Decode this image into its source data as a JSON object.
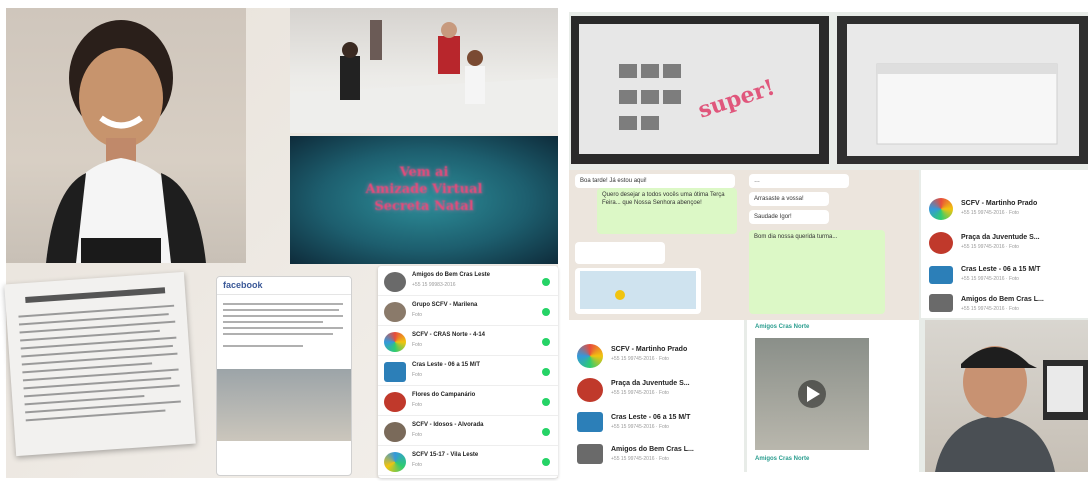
{
  "left_collage": {
    "banner_lines": [
      "Vem ai",
      "Amizade Virtual",
      "Secreta Natal"
    ],
    "fb_header": "facebook",
    "chat_list": [
      {
        "name": "Amigos do Bem Cras Leste",
        "sub": "+55 15 99983-2016"
      },
      {
        "name": "Grupo SCFV - Marilena",
        "sub": "Foto"
      },
      {
        "name": "SCFV - CRAS Norte - 4-14",
        "sub": "Foto"
      },
      {
        "name": "Cras Leste - 06 a 15 M/T",
        "sub": "Foto"
      },
      {
        "name": "Flores do Campanário",
        "sub": "Foto"
      },
      {
        "name": "SCFV - Idosos - Alvorada",
        "sub": "Foto"
      },
      {
        "name": "SCFV 15-17 - Vila Leste",
        "sub": "Foto"
      }
    ]
  },
  "right_collage": {
    "super_text": "super!",
    "bubbles": [
      "Boa tarde! Já estou aqui!",
      "Quero desejar a todos vocês uma ótima Terça Feira... que Nossa Senhora abençoe!",
      "Saudade Igor!",
      "Bom dia nossa querida turma...",
      "Arrasaste a vossa!"
    ],
    "list_right": [
      {
        "name": "SCFV - Martinho Prado",
        "sub": "+55 15 99745-2016 · Foto"
      },
      {
        "name": "Praça da Juventude S...",
        "sub": "+55 15 99745-2016 · Foto"
      },
      {
        "name": "Cras Leste - 06 a 15 M/T",
        "sub": "+55 15 99745-2016 · Foto"
      },
      {
        "name": "Amigos do Bem Cras L...",
        "sub": "+55 15 99745-2016 · Foto"
      }
    ],
    "list_bottom": [
      {
        "name": "SCFV - Martinho Prado",
        "sub": "+55 15 99745-2016 · Foto"
      },
      {
        "name": "Praça da Juventude S...",
        "sub": "+55 15 99745-2016 · Foto"
      },
      {
        "name": "Cras Leste - 06 a 15 M/T",
        "sub": "+55 15 99745-2016 · Foto"
      },
      {
        "name": "Amigos do Bem Cras L...",
        "sub": "+55 15 99745-2016 · Foto"
      }
    ],
    "video_caption": "Amigos Cras Norte"
  }
}
